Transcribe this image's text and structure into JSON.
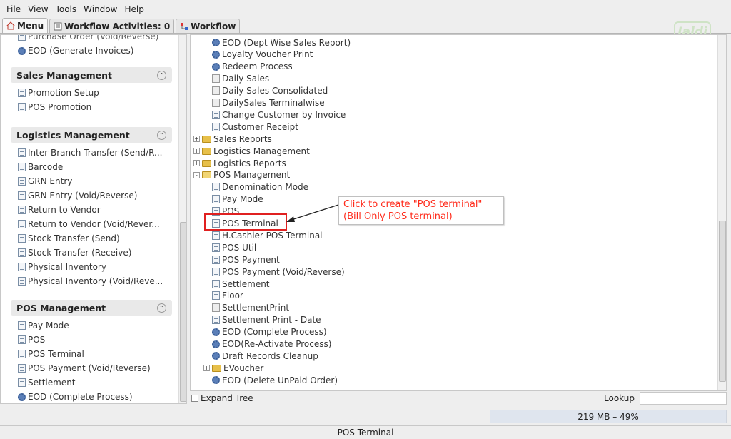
{
  "menubar": [
    "File",
    "View",
    "Tools",
    "Window",
    "Help"
  ],
  "tabs": [
    {
      "label": "Menu",
      "icon": "home-icon"
    },
    {
      "label": "Workflow Activities: 0",
      "icon": "calendar-icon"
    },
    {
      "label": "Workflow",
      "icon": "workflow-icon"
    }
  ],
  "logo_text": "Jaldi",
  "left": {
    "top_items": [
      {
        "label": "Purchase Order (Void/Reverse)",
        "icon": "doc"
      },
      {
        "label": "EOD (Generate Invoices)",
        "icon": "gear"
      }
    ],
    "sections": [
      {
        "title": "Sales Management",
        "items": [
          {
            "label": "Promotion Setup",
            "icon": "doc"
          },
          {
            "label": "POS Promotion",
            "icon": "doc"
          }
        ]
      },
      {
        "title": "Logistics Management",
        "items": [
          {
            "label": "Inter Branch Transfer (Send/R...",
            "icon": "doc"
          },
          {
            "label": "Barcode",
            "icon": "doc"
          },
          {
            "label": "GRN Entry",
            "icon": "doc"
          },
          {
            "label": "GRN Entry (Void/Reverse)",
            "icon": "doc"
          },
          {
            "label": "Return to Vendor",
            "icon": "doc"
          },
          {
            "label": "Return to Vendor (Void/Rever...",
            "icon": "doc"
          },
          {
            "label": "Stock Transfer (Send)",
            "icon": "doc"
          },
          {
            "label": "Stock Transfer (Receive)",
            "icon": "doc"
          },
          {
            "label": "Physical Inventory",
            "icon": "doc"
          },
          {
            "label": "Physical Inventory (Void/Reve...",
            "icon": "doc"
          }
        ]
      },
      {
        "title": "POS Management",
        "items": [
          {
            "label": "Pay Mode",
            "icon": "doc"
          },
          {
            "label": "POS",
            "icon": "doc"
          },
          {
            "label": "POS Terminal",
            "icon": "doc"
          },
          {
            "label": "POS Payment (Void/Reverse)",
            "icon": "doc"
          },
          {
            "label": "Settlement",
            "icon": "doc"
          },
          {
            "label": "EOD (Complete Process)",
            "icon": "gear"
          }
        ]
      }
    ]
  },
  "tree": [
    {
      "label": "EOD (Dept Wise Sales Report)",
      "icon": "gear"
    },
    {
      "label": "Loyalty Voucher Print",
      "icon": "gear"
    },
    {
      "label": "Redeem Process",
      "icon": "gear"
    },
    {
      "label": "Daily Sales",
      "icon": "blank"
    },
    {
      "label": "Daily Sales Consolidated",
      "icon": "blank"
    },
    {
      "label": "DailySales Terminalwise",
      "icon": "blank"
    },
    {
      "label": "Change Customer by Invoice",
      "icon": "doc"
    },
    {
      "label": "Customer Receipt",
      "icon": "doc"
    },
    {
      "label": "Sales Reports",
      "icon": "folder",
      "expander": "+"
    },
    {
      "label": "Logistics Management",
      "icon": "folder",
      "expander": "+"
    },
    {
      "label": "Logistics Reports",
      "icon": "folder",
      "expander": "+"
    },
    {
      "label": "POS Management",
      "icon": "folder-open",
      "expander": "-"
    },
    {
      "label": "Denomination Mode",
      "icon": "doc"
    },
    {
      "label": "Pay Mode",
      "icon": "doc"
    },
    {
      "label": "POS",
      "icon": "doc"
    },
    {
      "label": "POS Terminal",
      "icon": "doc"
    },
    {
      "label": "H.Cashier POS Terminal",
      "icon": "doc"
    },
    {
      "label": "POS Util",
      "icon": "doc"
    },
    {
      "label": "POS Payment",
      "icon": "doc"
    },
    {
      "label": "POS Payment (Void/Reverse)",
      "icon": "doc"
    },
    {
      "label": "Settlement",
      "icon": "doc"
    },
    {
      "label": "Floor",
      "icon": "doc"
    },
    {
      "label": "SettlementPrint",
      "icon": "blank"
    },
    {
      "label": "Settlement Print - Date",
      "icon": "doc"
    },
    {
      "label": "EOD (Complete Process)",
      "icon": "gear"
    },
    {
      "label": "EOD(Re-Activate Process)",
      "icon": "gear"
    },
    {
      "label": "Draft Records Cleanup",
      "icon": "gear"
    },
    {
      "label": "EVoucher",
      "icon": "folder",
      "expander": "+"
    },
    {
      "label": "EOD (Delete UnPaid Order)",
      "icon": "gear"
    }
  ],
  "callout": {
    "line1": "Click to create \"POS terminal\"",
    "line2": "(Bill Only POS terminal)"
  },
  "footer": {
    "expand_tree": "Expand Tree",
    "lookup": "Lookup",
    "lookup_value": ""
  },
  "memory": "219 MB – 49%",
  "status": "POS Terminal",
  "colors": {
    "callout_text": "#ff2a1a",
    "highlight": "#e02020"
  }
}
